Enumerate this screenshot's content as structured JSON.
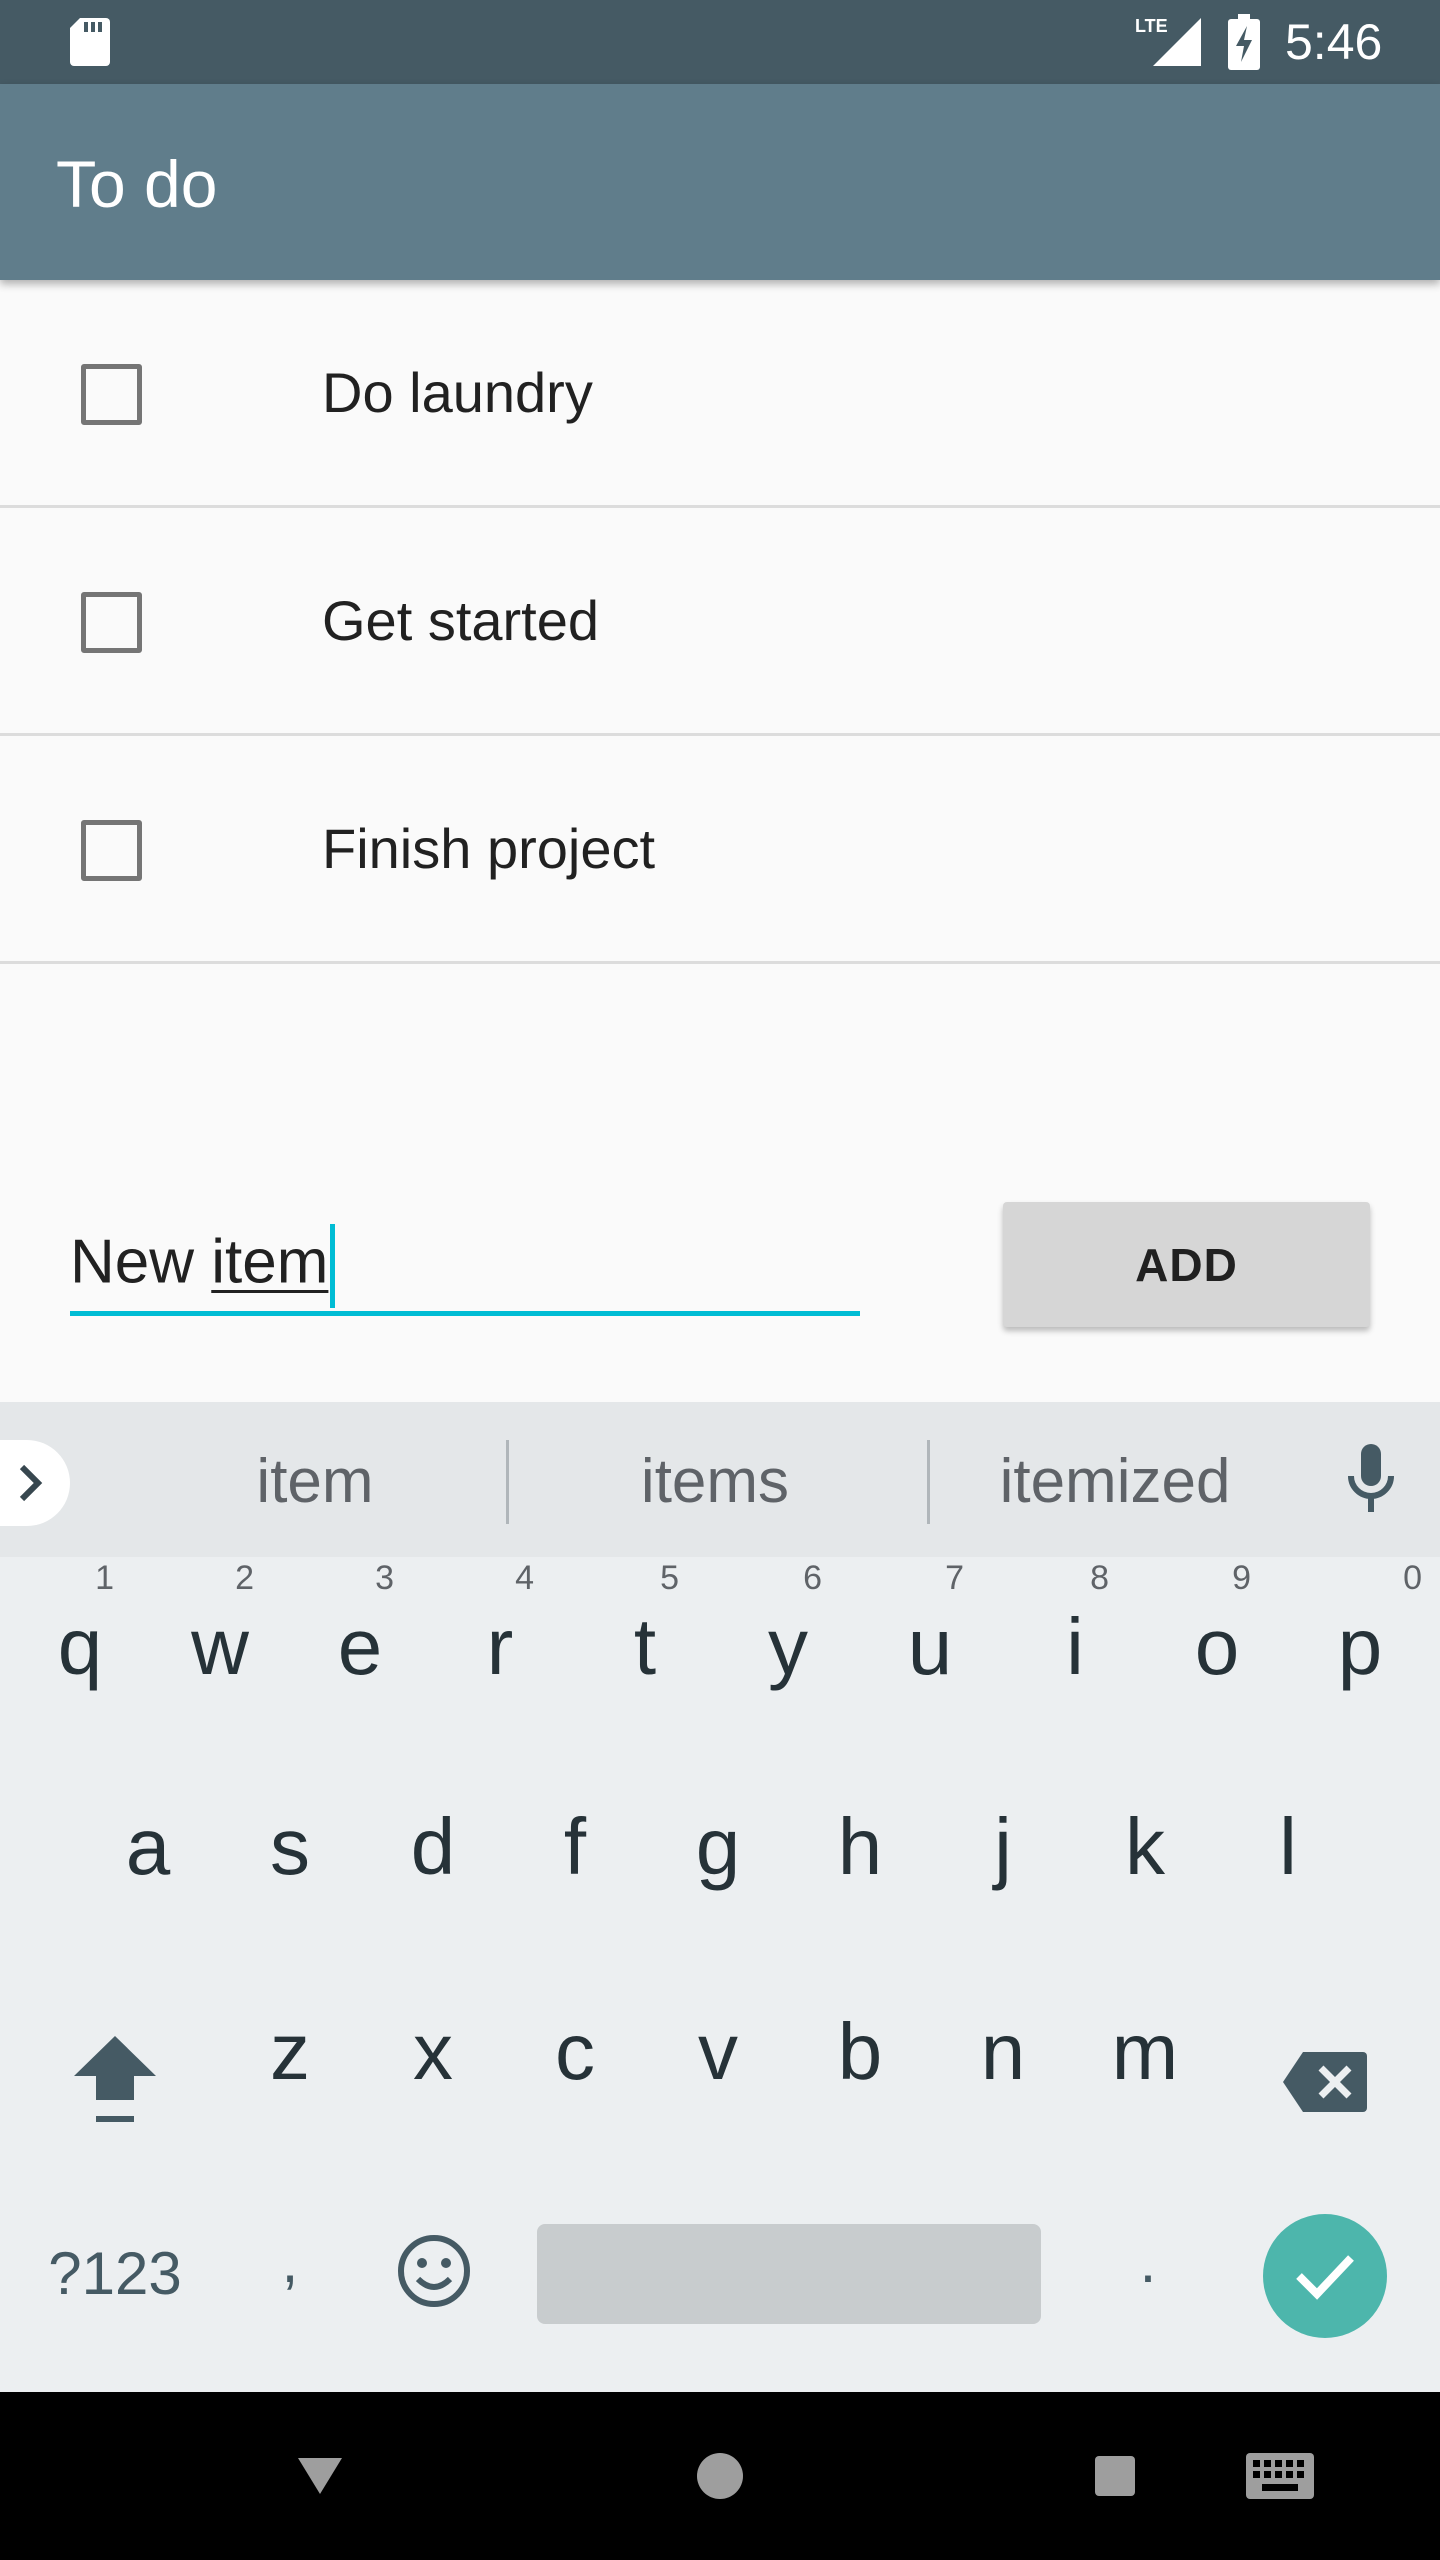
{
  "status_bar": {
    "time": "5:46",
    "network_label": "LTE",
    "icons": [
      "sd-card-icon",
      "lte-signal-icon",
      "battery-charging-icon"
    ]
  },
  "app_bar": {
    "title": "To do"
  },
  "todo_items": [
    {
      "label": "Do laundry",
      "checked": false
    },
    {
      "label": "Get started",
      "checked": false
    },
    {
      "label": "Finish project",
      "checked": false
    }
  ],
  "new_item": {
    "typed_prefix": "New ",
    "composing_word": "item",
    "value": "New item"
  },
  "add_button": {
    "label": "ADD"
  },
  "keyboard": {
    "suggestions": [
      "item",
      "items",
      "itemized"
    ],
    "row1": [
      "q",
      "w",
      "e",
      "r",
      "t",
      "y",
      "u",
      "i",
      "o",
      "p"
    ],
    "row1_hints": [
      "1",
      "2",
      "3",
      "4",
      "5",
      "6",
      "7",
      "8",
      "9",
      "0"
    ],
    "row2": [
      "a",
      "s",
      "d",
      "f",
      "g",
      "h",
      "j",
      "k",
      "l"
    ],
    "row3": [
      "z",
      "x",
      "c",
      "v",
      "b",
      "n",
      "m"
    ],
    "symbols_label": "?123",
    "comma": ",",
    "period": "."
  },
  "colors": {
    "status_bar": "#455a64",
    "app_bar": "#607d8b",
    "accent": "#00bcd4",
    "done_key": "#4db6ac"
  }
}
